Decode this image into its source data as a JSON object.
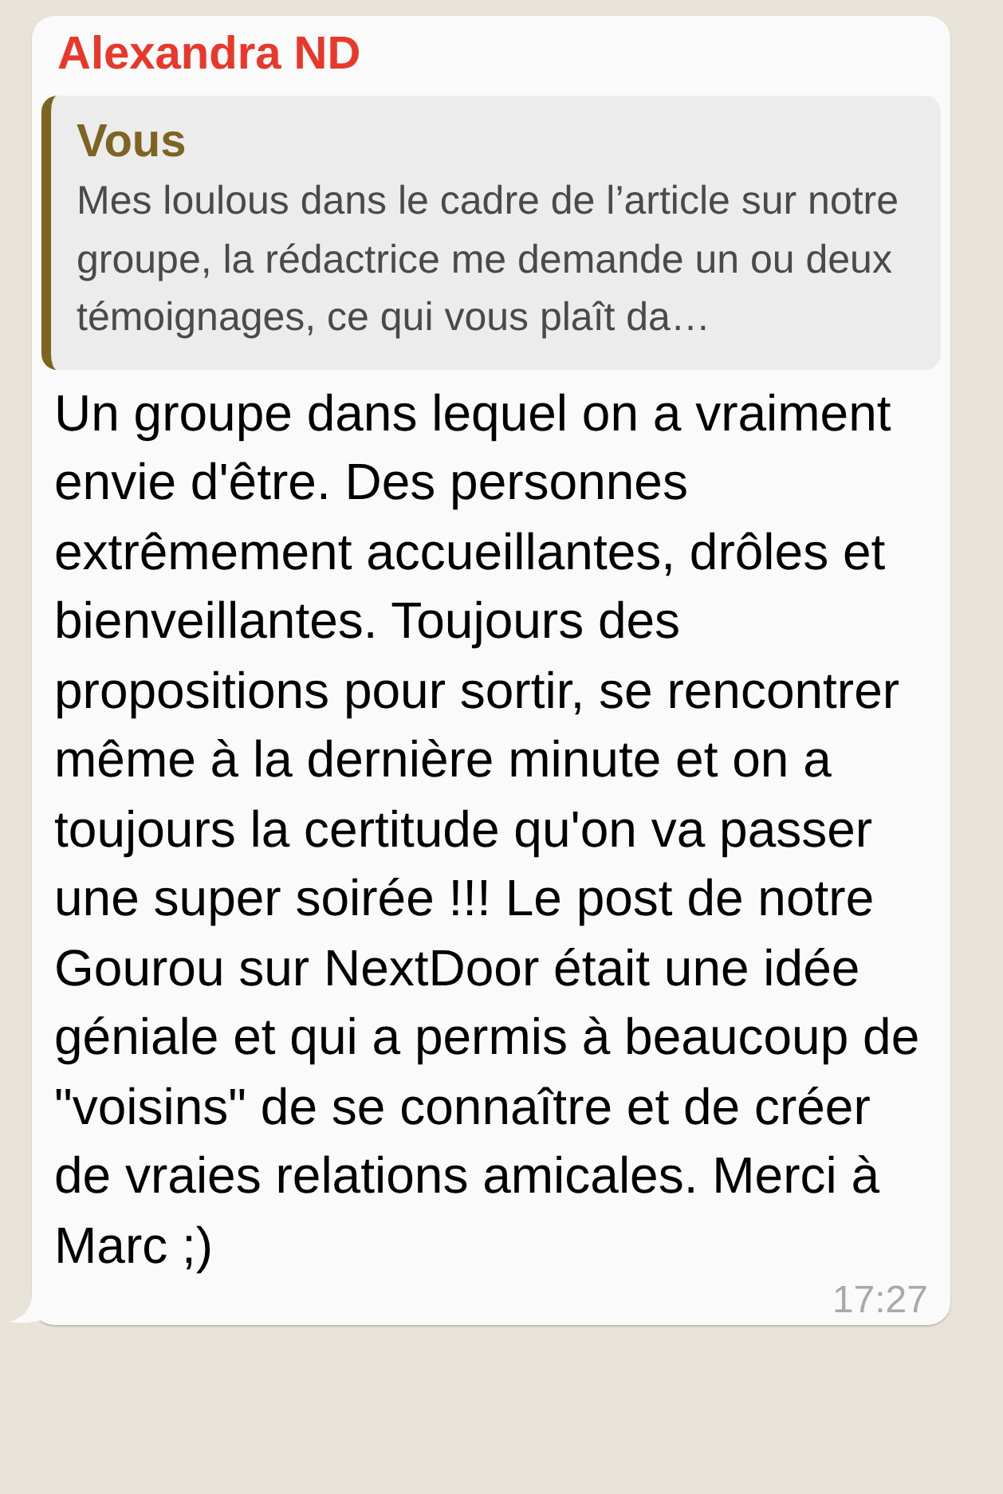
{
  "message": {
    "sender": "Alexandra ND",
    "quote": {
      "author": "Vous",
      "text": "Mes loulous dans le cadre de l’article sur notre groupe, la rédactrice me demande un ou deux témoignages, ce qui vous plaît da…"
    },
    "text": "Un groupe dans lequel on a vraiment envie d'être. Des personnes extrêmement accueillantes, drôles et bienveillantes. Toujours des propositions pour sortir, se rencontrer même à la dernière minute et on a toujours la certitude qu'on va passer une super soirée !!! Le post de notre Gourou sur NextDoor était une idée géniale et qui a permis à beaucoup de \"voisins\" de se connaître et de créer de vraies relations amicales. Merci à Marc ;)",
    "time": "17:27"
  }
}
